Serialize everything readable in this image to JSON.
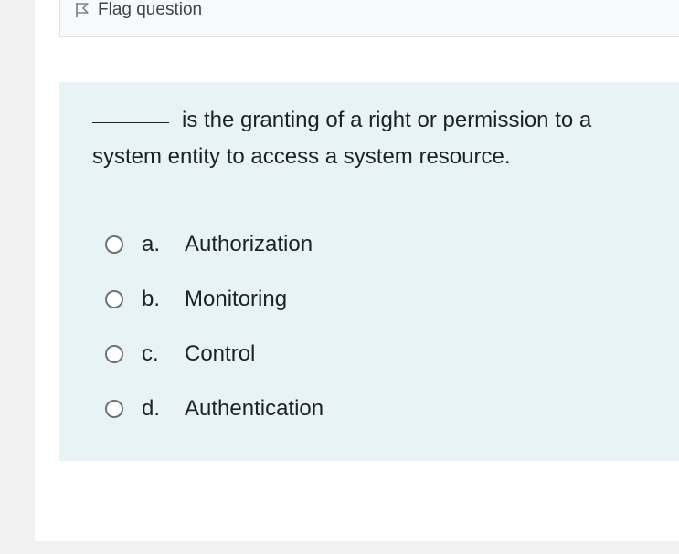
{
  "flag": {
    "label": "Flag question",
    "icon": "flag-icon"
  },
  "question": {
    "blank_indicator": "_______",
    "text": "is the granting of a right or permission to a system entity to access a system resource."
  },
  "answers": [
    {
      "letter": "a.",
      "text": "Authorization"
    },
    {
      "letter": "b.",
      "text": "Monitoring"
    },
    {
      "letter": "c.",
      "text": "Control"
    },
    {
      "letter": "d.",
      "text": "Authentication"
    }
  ],
  "colors": {
    "question_background": "#e7f3f5",
    "info_background": "#f8f9fa",
    "page_background": "#f2f2f2"
  }
}
